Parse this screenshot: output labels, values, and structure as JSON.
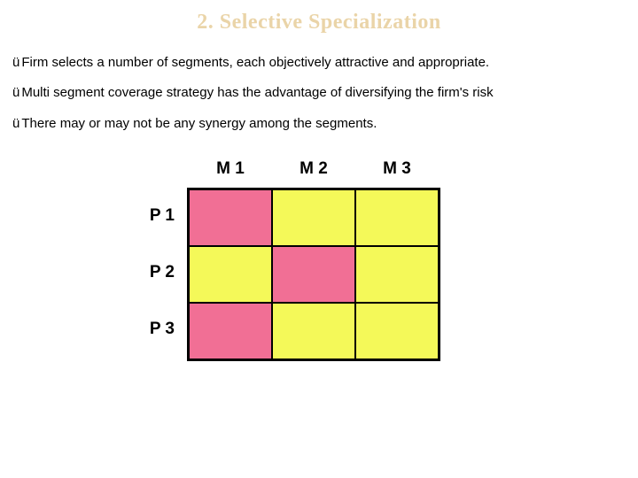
{
  "title": "2. Selective Specialization",
  "bullets": {
    "b1": "Firm selects a number of segments, each objectively attractive and appropriate.",
    "b2": "Multi segment coverage strategy has the advantage of diversifying the firm's risk",
    "b3": "There may or may not be any synergy among the segments."
  },
  "check_glyph": "ü",
  "matrix": {
    "cols": {
      "c1": "M 1",
      "c2": "M 2",
      "c3": "M 3"
    },
    "rows": {
      "r1": "P 1",
      "r2": "P 2",
      "r3": "P 3"
    }
  },
  "chart_data": {
    "type": "table",
    "title": "Selective Specialization product-market grid",
    "row_labels": [
      "P 1",
      "P 2",
      "P 3"
    ],
    "col_labels": [
      "M 1",
      "M 2",
      "M 3"
    ],
    "cells": [
      [
        "selected",
        "not-selected",
        "not-selected"
      ],
      [
        "not-selected",
        "selected",
        "not-selected"
      ],
      [
        "selected",
        "not-selected",
        "not-selected"
      ]
    ],
    "legend": {
      "selected": "#f16f95",
      "not-selected": "#f4f959"
    }
  }
}
